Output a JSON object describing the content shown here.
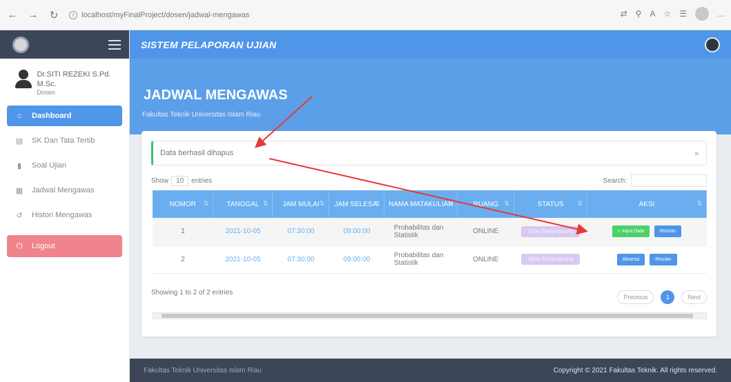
{
  "browser": {
    "url": "localhost/myFinalProject/dosen/jadwal-mengawas",
    "right_icons": [
      "translate-icon",
      "zoom-icon",
      "reader-icon",
      "favorites-icon",
      "collections-icon",
      "profile-icon",
      "more-icon"
    ]
  },
  "sidebar": {
    "user_name": "Dr.SITI REZEKI S.Pd. M.Sc.",
    "user_role": "Dosen",
    "items": [
      {
        "label": "Dashboard",
        "icon": "home-icon"
      },
      {
        "label": "SK Dan Tata Tertib",
        "icon": "document-icon"
      },
      {
        "label": "Soal Ujian",
        "icon": "file-icon"
      },
      {
        "label": "Jadwal Mengawas",
        "icon": "calendar-icon"
      },
      {
        "label": "Histori Mengawas",
        "icon": "history-icon"
      }
    ],
    "logout_label": "Logout"
  },
  "topbar": {
    "brand": "SISTEM PELAPORAN UJIAN"
  },
  "header": {
    "title": "JADWAL MENGAWAS",
    "subtitle": "Fakultas Teknik Universitas Islam Riau"
  },
  "alert": {
    "message": "Data berhasil dihapus",
    "close": "×"
  },
  "table_controls": {
    "show_label": "Show",
    "entries_value": "10",
    "entries_label": "entries",
    "search_label": "Search:"
  },
  "table": {
    "headers": [
      "NOMOR",
      "TANGGAL",
      "JAM MULAI",
      "JAM SELESAI",
      "NAMA MATAKULIAH",
      "RUANG",
      "STATUS",
      "AKSI"
    ],
    "rows": [
      {
        "nomor": "1",
        "tanggal": "2021-10-05",
        "jam_mulai": "07:30:00",
        "jam_selesai": "09:00:00",
        "matakuliah": "Probabilitas dan Statistik",
        "ruang": "ONLINE",
        "status": "Ujian Berlangsung",
        "btn1": "+ Input Data",
        "btn2": "Rincian"
      },
      {
        "nomor": "2",
        "tanggal": "2021-10-05",
        "jam_mulai": "07:30:00",
        "jam_selesai": "09:00:00",
        "matakuliah": "Probabilitas dan Statistik",
        "ruang": "ONLINE",
        "status": "Ujian Berlangsung",
        "btn1": "Absensi",
        "btn2": "Rincian"
      }
    ]
  },
  "table_info": "Showing 1 to 2 of 2 entries",
  "pagination": {
    "previous": "Previous",
    "page": "1",
    "next": "Next"
  },
  "footer": {
    "left": "Fakultas Teknik Universitas Islam Riau",
    "right": "Copyright © 2021 Fakultas Teknik. All rights reserved."
  },
  "colors": {
    "primary": "#4f95e8",
    "dark": "#3d4658",
    "success": "#4bd16b",
    "danger": "#f0848d",
    "annotation": "#e53935"
  }
}
